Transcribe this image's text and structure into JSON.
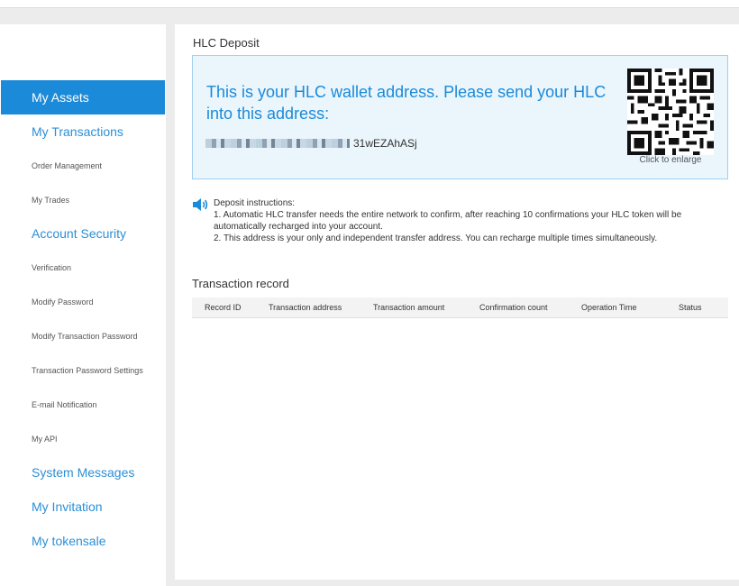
{
  "sidebar": {
    "items": [
      {
        "label": "My Assets",
        "type": "main",
        "active": true
      },
      {
        "label": "My Transactions",
        "type": "main"
      },
      {
        "label": "Order Management",
        "type": "sub"
      },
      {
        "label": "My Trades",
        "type": "sub"
      },
      {
        "label": "Account Security",
        "type": "main"
      },
      {
        "label": "Verification",
        "type": "sub"
      },
      {
        "label": "Modify Password",
        "type": "sub"
      },
      {
        "label": "Modify Transaction Password",
        "type": "sub"
      },
      {
        "label": "Transaction Password Settings",
        "type": "sub"
      },
      {
        "label": "E-mail Notification",
        "type": "sub"
      },
      {
        "label": "My API",
        "type": "sub"
      },
      {
        "label": "System Messages",
        "type": "main"
      },
      {
        "label": "My Invitation",
        "type": "main"
      },
      {
        "label": "My tokensale",
        "type": "main"
      }
    ]
  },
  "deposit": {
    "title": "HLC Deposit",
    "message": "This is your HLC wallet address. Please send your HLC into this address:",
    "address_visible_suffix": "31wEZAhASj",
    "qr_caption": "Click to enlarge"
  },
  "instructions": {
    "heading": "Deposit instructions:",
    "line1": "1. Automatic HLC transfer needs the entire network to confirm, after reaching 10 confirmations your HLC token will be automatically recharged into your account.",
    "line2": "2. This address is your only and independent transfer address. You can recharge multiple times simultaneously."
  },
  "transactions": {
    "title": "Transaction record",
    "columns": [
      "Record ID",
      "Transaction address",
      "Transaction amount",
      "Confirmation count",
      "Operation Time",
      "Status"
    ]
  },
  "colors": {
    "accent": "#1b8ad8",
    "link": "#2b8fd6",
    "deposit_bg": "#eaf5fc",
    "deposit_border": "#9fd0ef"
  },
  "icons": {
    "speaker": "speaker-icon",
    "qr": "qr-code-icon"
  }
}
